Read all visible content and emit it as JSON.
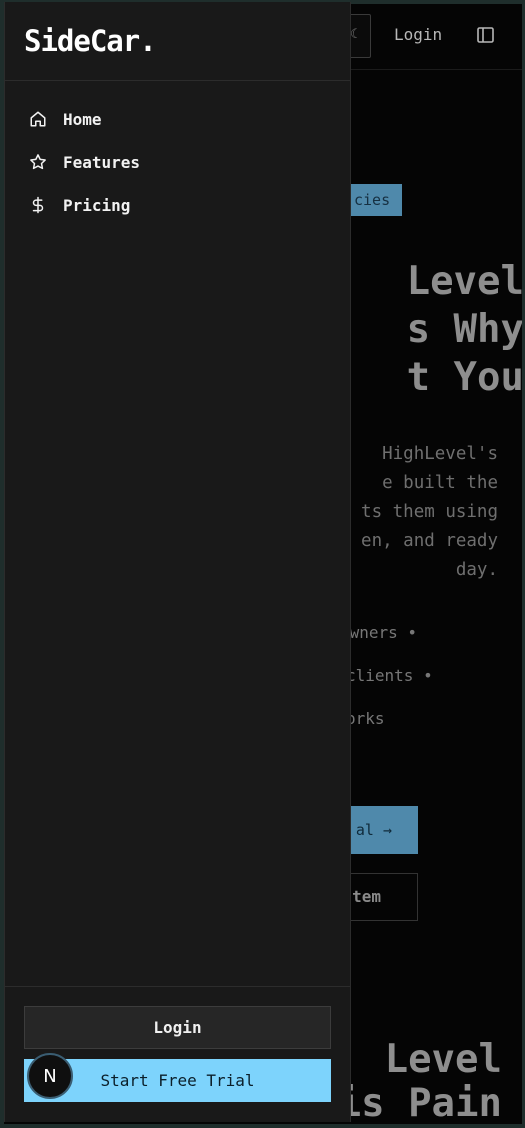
{
  "background_page": {
    "nav": {
      "login_label": "Login"
    },
    "badge": "cies",
    "hero_title": "Level\ns Why\nt You",
    "hero_text": "HighLevel's\ne built the\nts them using\nen, and ready\nday.",
    "features": [
      "owners  •",
      "clients  •",
      "orks"
    ],
    "primary_cta": "al →",
    "secondary_cta": "tem",
    "section_title": "Level\nis Pain"
  },
  "drawer": {
    "brand": "SideCar.",
    "nav_items": [
      {
        "label": "Home",
        "icon": "home-icon"
      },
      {
        "label": "Features",
        "icon": "star-icon"
      },
      {
        "label": "Pricing",
        "icon": "dollar-icon"
      }
    ],
    "login_label": "Login",
    "trial_label": "Start Free Trial"
  },
  "dev_badge": {
    "letter": "N"
  },
  "colors": {
    "accent": "#7dd3fc",
    "drawer_bg": "#191919",
    "page_bg": "#050505"
  }
}
